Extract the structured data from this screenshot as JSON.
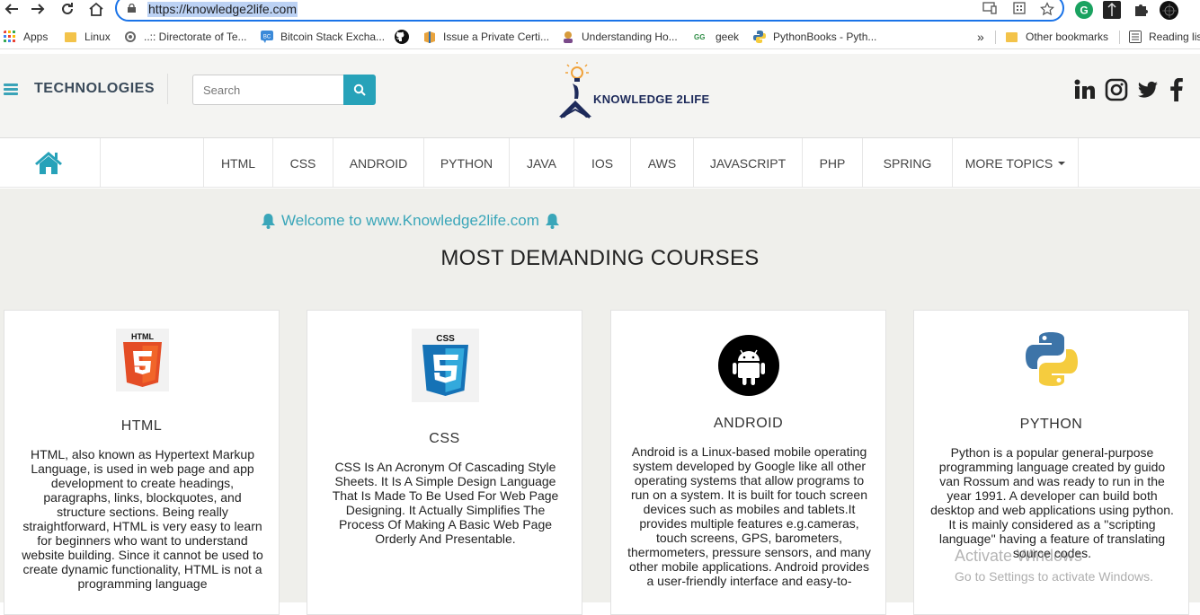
{
  "browser": {
    "url": "https://knowledge2life.com",
    "bookmarks": [
      {
        "label": "Apps",
        "icon": "apps-grid-icon"
      },
      {
        "label": "Linux",
        "icon": "folder-icon"
      },
      {
        "label": "..:: Directorate of Te...",
        "icon": "gear-icon"
      },
      {
        "label": "Bitcoin Stack Excha...",
        "icon": "stackexchange-icon"
      },
      {
        "label": "",
        "icon": "github-icon"
      },
      {
        "label": "Issue a Private Certi...",
        "icon": "certificate-icon"
      },
      {
        "label": "Understanding Ho...",
        "icon": "avatar-icon"
      },
      {
        "label": "geek",
        "icon": "geeksforgeeks-icon"
      },
      {
        "label": "PythonBooks - Pyth...",
        "icon": "python-icon"
      }
    ],
    "bookmarks_overflow": "»",
    "other_bookmarks": "Other bookmarks",
    "reading_list": "Reading lis"
  },
  "header": {
    "brand": "TECHNOLOGIES",
    "search_placeholder": "Search",
    "logo_text": "KNOWLEDGE 2LIFE",
    "social": [
      "linkedin-icon",
      "instagram-icon",
      "twitter-icon",
      "facebook-icon"
    ]
  },
  "nav": {
    "items": [
      "HTML",
      "CSS",
      "ANDROID",
      "PYTHON",
      "JAVA",
      "IOS",
      "AWS",
      "JAVASCRIPT",
      "PHP",
      "SPRING"
    ],
    "more": "MORE TOPICS"
  },
  "main": {
    "welcome": "Welcome to www.Knowledge2life.com",
    "section_title": "MOST DEMANDING COURSES",
    "cards": [
      {
        "title": "HTML",
        "text": "HTML, also known as Hypertext Markup Language, is used in web page and app development to create headings, paragraphs, links, blockquotes, and structure sections. Being really straightforward, HTML is very easy to learn for beginners who want to understand website building. Since it cannot be used to create dynamic functionality, HTML is not a programming language"
      },
      {
        "title": "CSS",
        "text": "CSS Is An Acronym Of Cascading Style Sheets. It Is A Simple Design Language That Is Made To Be Used For Web Page Designing. It Actually Simplifies The Process Of Making A Basic Web Page Orderly And Presentable."
      },
      {
        "title": "ANDROID",
        "text": "Android is a Linux-based mobile operating system developed by Google like all other operating systems that allow programs to run on a system. It is built for touch screen devices such as mobiles and tablets.It provides multiple features e.g.cameras, touch screens, GPS, barometers, thermometers, pressure sensors, and many other mobile applications. Android provides a user-friendly interface and easy-to-"
      },
      {
        "title": "PYTHON",
        "text": "Python is a popular general-purpose programming language created by guido van Rossum and was ready to run in the year 1991. A developer can build both desktop and web applications using python. It is mainly considered as a ''scripting language'' having a feature of translating source codes."
      }
    ]
  },
  "watermark": {
    "line1": "Activate Windows",
    "line2": "Go to Settings to activate Windows."
  },
  "colors": {
    "accent": "#27a2b9",
    "omnibox_border": "#1a73e8",
    "page_bg": "#efefeb"
  }
}
